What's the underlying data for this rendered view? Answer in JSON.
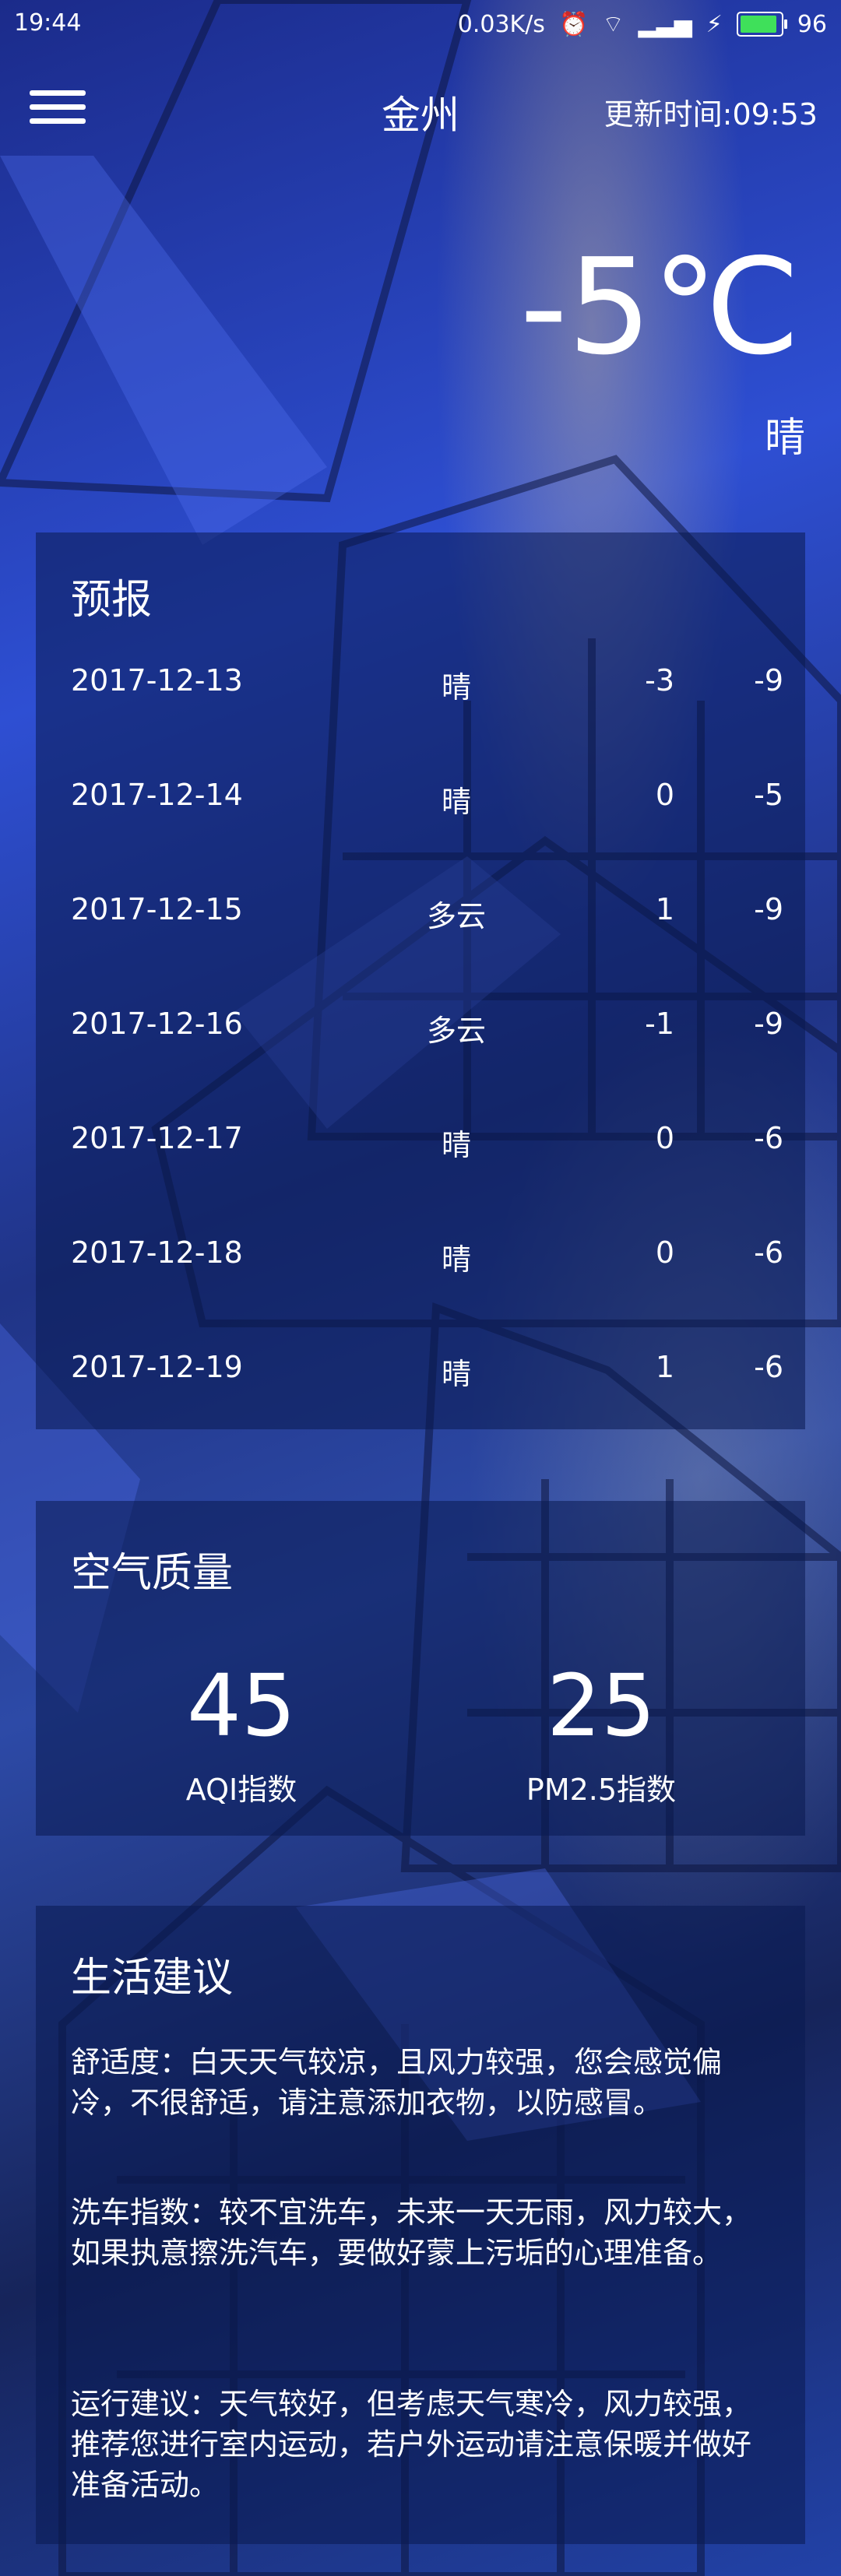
{
  "status_bar": {
    "time": "19:44",
    "speed": "0.03K/s",
    "battery": "96",
    "battery_level": 0.96
  },
  "header": {
    "menu_icon": "hamburger-menu-icon",
    "city": "金州",
    "update_time": "更新时间:09:53"
  },
  "now": {
    "temperature": "-5℃",
    "condition": "晴"
  },
  "forecast": {
    "title": "预报",
    "rows": [
      {
        "date": "2017-12-13",
        "condition": "晴",
        "max": "-3",
        "min": "-9"
      },
      {
        "date": "2017-12-14",
        "condition": "晴",
        "max": "0",
        "min": "-5"
      },
      {
        "date": "2017-12-15",
        "condition": "多云",
        "max": "1",
        "min": "-9"
      },
      {
        "date": "2017-12-16",
        "condition": "多云",
        "max": "-1",
        "min": "-9"
      },
      {
        "date": "2017-12-17",
        "condition": "晴",
        "max": "0",
        "min": "-6"
      },
      {
        "date": "2017-12-18",
        "condition": "晴",
        "max": "0",
        "min": "-6"
      },
      {
        "date": "2017-12-19",
        "condition": "晴",
        "max": "1",
        "min": "-6"
      }
    ]
  },
  "air_quality": {
    "title": "空气质量",
    "aqi_value": "45",
    "aqi_label": "AQI指数",
    "pm25_value": "25",
    "pm25_label": "PM2.5指数"
  },
  "suggestion": {
    "title": "生活建议",
    "comfort": "舒适度：白天天气较凉，且风力较强，您会感觉偏冷，不很舒适，请注意添加衣物，以防感冒。",
    "car_wash": "洗车指数：较不宜洗车，未来一天无雨，风力较大，如果执意擦洗汽车，要做好蒙上污垢的心理准备。",
    "sport": "运行建议：天气较好，但考虑天气寒冷，风力较强，推荐您进行室内运动，若户外运动请注意保暖并做好准备活动。"
  },
  "colors": {
    "panel": "rgba(10,25,80,0.55)",
    "text": "#ffffff",
    "battery": "#3fe05a"
  }
}
